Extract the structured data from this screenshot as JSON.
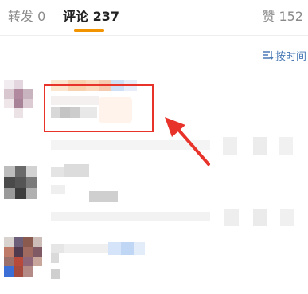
{
  "tabs": [
    {
      "label": "转发 0",
      "active": false
    },
    {
      "label": "评论 237",
      "active": true
    },
    {
      "label": "赞 152",
      "active": false
    }
  ],
  "sort": {
    "label": "按时间",
    "icon": "sort-icon"
  },
  "colors": {
    "accent": "#f29300",
    "link": "#4a79b5",
    "highlight": "#e8332b"
  }
}
